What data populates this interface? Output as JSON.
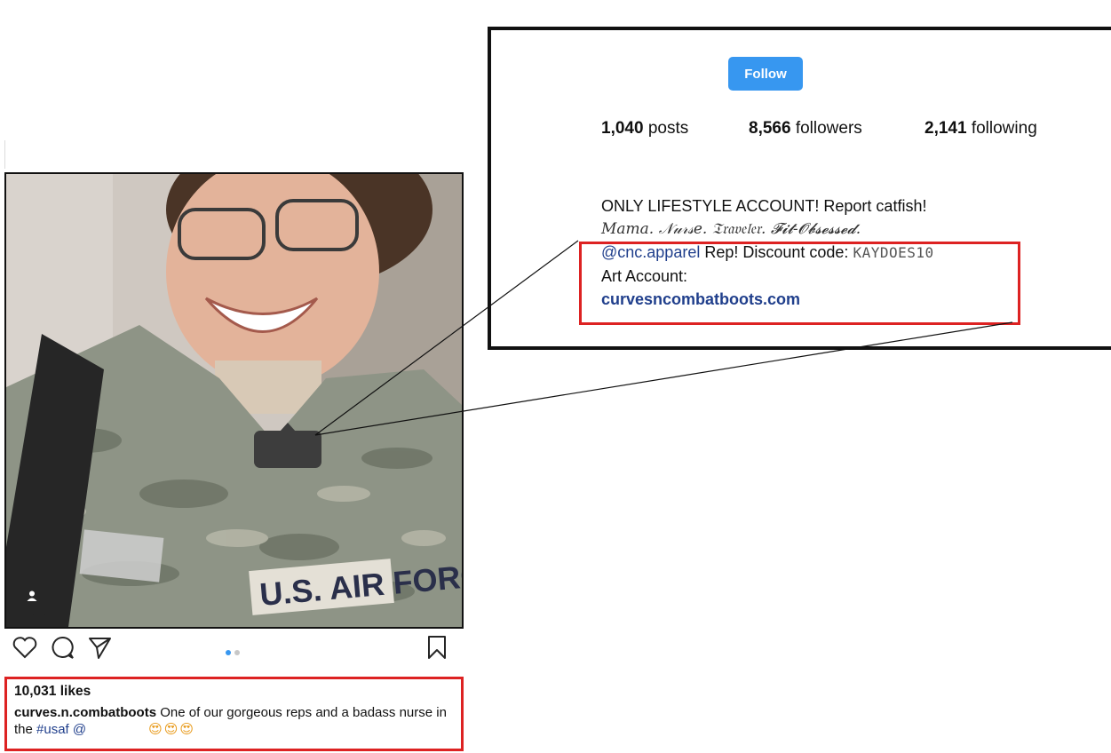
{
  "post": {
    "photo_alt": "",
    "likes": "10,031 likes",
    "caption": {
      "username": "curves.n.combatboots",
      "text_1": " One of our gorgeous reps and a badass nurse in the ",
      "hashtag": "#usaf",
      "mention": " @",
      "emojis": [
        "😍",
        "😍",
        "😍"
      ]
    },
    "carousel": {
      "total": 2,
      "current": 1
    },
    "uniform_text": "U.S. AIR FORCE"
  },
  "profile": {
    "follow_label": "Follow",
    "stats": [
      {
        "value": "1,040",
        "label": "posts"
      },
      {
        "value": "8,566",
        "label": "followers"
      },
      {
        "value": "2,141",
        "label": "following"
      }
    ],
    "bio": {
      "line1": "ONLY LIFESTYLE ACCOUNT! Report catfish!",
      "line2": "Mama. 𝒩𝓊𝓇𝓈𝑒. 𝔗𝔯𝔞𝔳𝔢𝔩𝔢𝔯. 𝓕𝓲𝓽-𝓞𝓫𝓼𝓮𝓼𝓼𝓮𝓭.",
      "line3_mention": "@cnc.apparel",
      "line3_text": " Rep! Discount code: ",
      "line3_code": "KAYDOES10",
      "line4": "Art Account:",
      "line5_link": "curvesncombatboots.com"
    }
  },
  "colors": {
    "follow_button": "#3797f0",
    "highlight_border": "#dd2222",
    "link": "#203f8c"
  },
  "icons": [
    "heart-icon",
    "comment-icon",
    "share-icon",
    "bookmark-icon",
    "user-tag-icon"
  ]
}
